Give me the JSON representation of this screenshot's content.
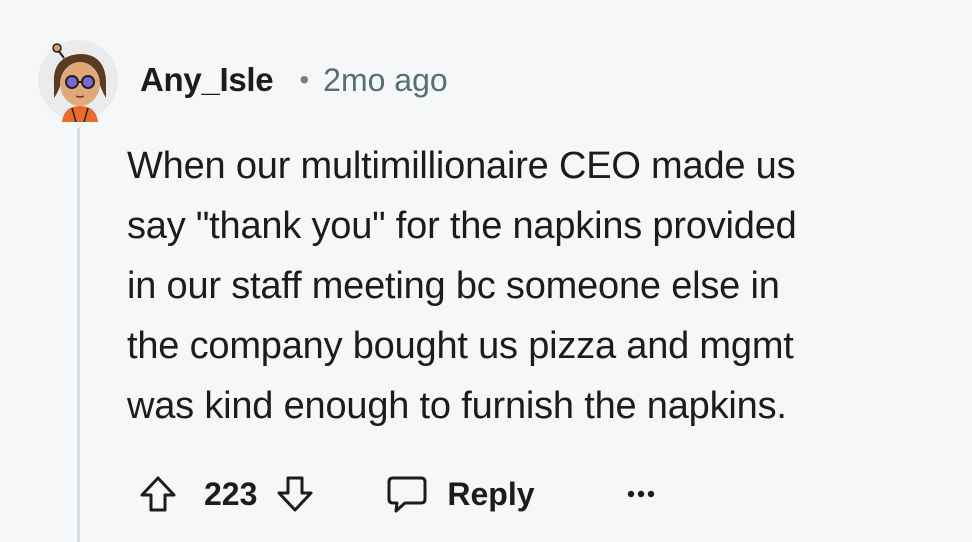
{
  "comment": {
    "author": "Any_Isle",
    "separator": "•",
    "time": "2mo ago",
    "body_lines": [
      "When our multimillionaire CEO made us",
      "say \"thank you\" for the napkins provided",
      "in our staff meeting bc someone else in",
      "the company bought us pizza and mgmt",
      "was kind enough to furnish the napkins."
    ],
    "score": "223",
    "reply_label": "Reply",
    "icons": {
      "upvote": "upvote-arrow-icon",
      "downvote": "downvote-arrow-icon",
      "reply": "speech-bubble-icon",
      "more": "ellipsis-icon"
    }
  },
  "colors": {
    "background": "#f6f7f8",
    "text": "#1c1c1c",
    "muted": "#576f76",
    "thread_line": "#dadde0"
  }
}
